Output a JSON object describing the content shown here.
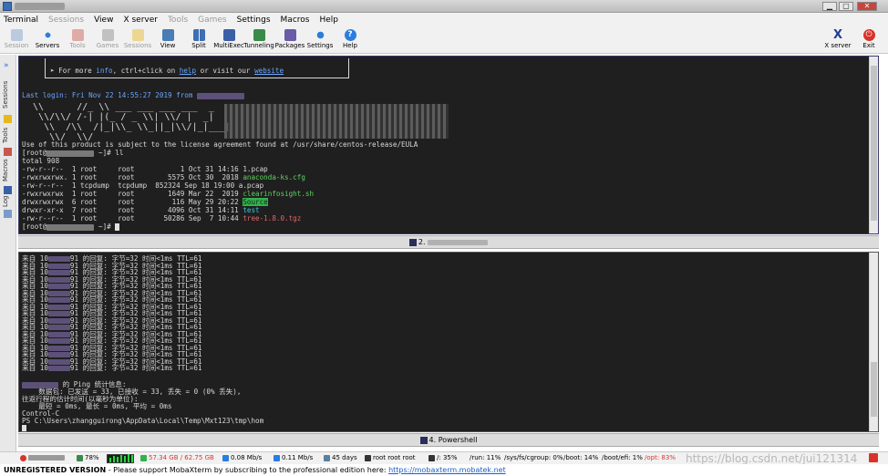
{
  "menubar": {
    "items": [
      {
        "label": "Terminal",
        "enabled": true
      },
      {
        "label": "Sessions",
        "enabled": false
      },
      {
        "label": "View",
        "enabled": true
      },
      {
        "label": "X server",
        "enabled": true
      },
      {
        "label": "Tools",
        "enabled": false
      },
      {
        "label": "Games",
        "enabled": false
      },
      {
        "label": "Settings",
        "enabled": true
      },
      {
        "label": "Macros",
        "enabled": true
      },
      {
        "label": "Help",
        "enabled": true
      }
    ]
  },
  "toolbar": {
    "session": "Session",
    "servers": "Servers",
    "tools": "Tools",
    "games": "Games",
    "sessions": "Sessions",
    "view": "View",
    "split": "Split",
    "multiexec": "MultiExec",
    "tunneling": "Tunneling",
    "packages": "Packages",
    "settings": "Settings",
    "help": "Help",
    "xserver": "X server",
    "exit": "Exit"
  },
  "sidebar": {
    "sessions": "Sessions",
    "tools": "Tools",
    "macros": "Macros",
    "log": "Log"
  },
  "pane1": {
    "info_prefix": "➤ For more ",
    "info_word": "info",
    "info_mid": ", ctrl+click on ",
    "help_link": "help",
    "info_mid2": " or visit our ",
    "website_link": "website",
    "last_login": "Last login: Fri Nov 22 14:55:27 2019 from ",
    "art": "  \\\\      //_ \\\\ ___ ___ ___ ___  _\n   \\\\/\\\\/ /-| |(_ / _ \\\\| \\\\/ |  _|\n    \\\\  /\\\\  /|_|\\\\_ \\\\_||_|\\\\/|_|___|\n     \\\\/  \\\\/ ",
    "eula": "Use of this product is subject to the license agreement found at /usr/share/centos-release/EULA",
    "prompt1_prefix": "[root@",
    "prompt1_suffix": " ~]# ll",
    "total": "total 908",
    "files": [
      {
        "meta": "-rw-r--r--  1 root     root           1 Oct 31 14:16 ",
        "name": "1.pcap",
        "color": "plain"
      },
      {
        "meta": "-rwxrwxrwx. 1 root     root        5575 Oct 30  2018 ",
        "name": "anaconda-ks.cfg",
        "color": "green"
      },
      {
        "meta": "-rw-r--r--  1 tcpdump  tcpdump  852324 Sep 18 19:00 ",
        "name": "a.pcap",
        "color": "plain"
      },
      {
        "meta": "-rwxrwxrwx  1 root     root        1649 Mar 22  2019 ",
        "name": "clearinfosight.sh",
        "color": "green"
      },
      {
        "meta": "drwxrwxrwx  6 root     root         116 May 29 20:22 ",
        "name": "Source",
        "color": "highlight"
      },
      {
        "meta": "drwxr-xr-x  7 root     root        4096 Oct 31 14:11 ",
        "name": "test",
        "color": "cyan"
      },
      {
        "meta": "-rw-r--r--  1 root     root       50286 Sep  7 10:44 ",
        "name": "tree-1.8.0.tgz",
        "color": "red"
      }
    ],
    "prompt2_prefix": "[root@",
    "prompt2_suffix": " ~]# ",
    "tab_label": "2. "
  },
  "pane2": {
    "reply_prefix": "来自 10",
    "reply_mid": "91 的回复: 字节=32 时间<1ms TTL=61",
    "reply_count": 17,
    "stats_header": " 的 Ping 统计信息:",
    "stats_packets": "    数据包: 已发送 = 33, 已接收 = 33, 丢失 = 0 (0% 丢失),",
    "stats_rtt_header": "往返行程的估计时间(以毫秒为单位):",
    "stats_rtt": "    最短 = 0ms, 最长 = 0ms, 平均 = 0ms",
    "ctrl_c": "Control-C",
    "ps_prompt": "PS C:\\Users\\zhangguirong\\AppData\\Local\\Temp\\Mxt123\\tmp\\hom",
    "tab_label": "4. Powershell"
  },
  "statusbar": {
    "cpu": "78%",
    "memory": "57.34 GB / 62.75 GB",
    "upload": "0.08 Mb/s",
    "download": "0.11 Mb/s",
    "uptime": "45 days",
    "users": "root  root  root",
    "root_fs": "/: 35%",
    "run_fs": "/run: 11%",
    "cgroup_fs": "/sys/fs/cgroup: 0%",
    "boot_fs": "/boot: 14%",
    "bootefi_fs": "/boot/efi: 1%",
    "opt_fs": "/opt: 83%",
    "watermark": "https://blog.csdn.net/jui121314"
  },
  "unregistered": {
    "label": "UNREGISTERED VERSION",
    "message": "  -  Please support MobaXterm by subscribing to the professional edition here:  ",
    "link": "https://mobaxterm.mobatek.net"
  }
}
